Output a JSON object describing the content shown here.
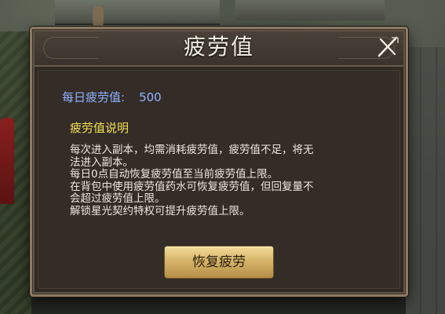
{
  "dialog": {
    "title": "疲劳值",
    "fatigue_label": "每日疲劳值:",
    "fatigue_value": "500",
    "section_title": "疲劳值说明",
    "description": [
      "每次进入副本，均需消耗疲劳值，疲劳值不足，将无",
      "法进入副本。",
      "每日0点自动恢复疲劳值至当前疲劳值上限。",
      "在背包中使用疲劳值药水可恢复疲劳值，但回复量不",
      "会超过疲劳值上限。",
      "解锁星光契约特权可提升疲劳值上限。"
    ],
    "restore_button": "恢复疲劳",
    "close_icon": "close-icon"
  },
  "colors": {
    "title": "#f4efe4",
    "fatigue_text": "#8fb4ff",
    "section_title": "#f2e052",
    "body_text": "#ece7dd",
    "button_gold": "#d6b56a"
  }
}
